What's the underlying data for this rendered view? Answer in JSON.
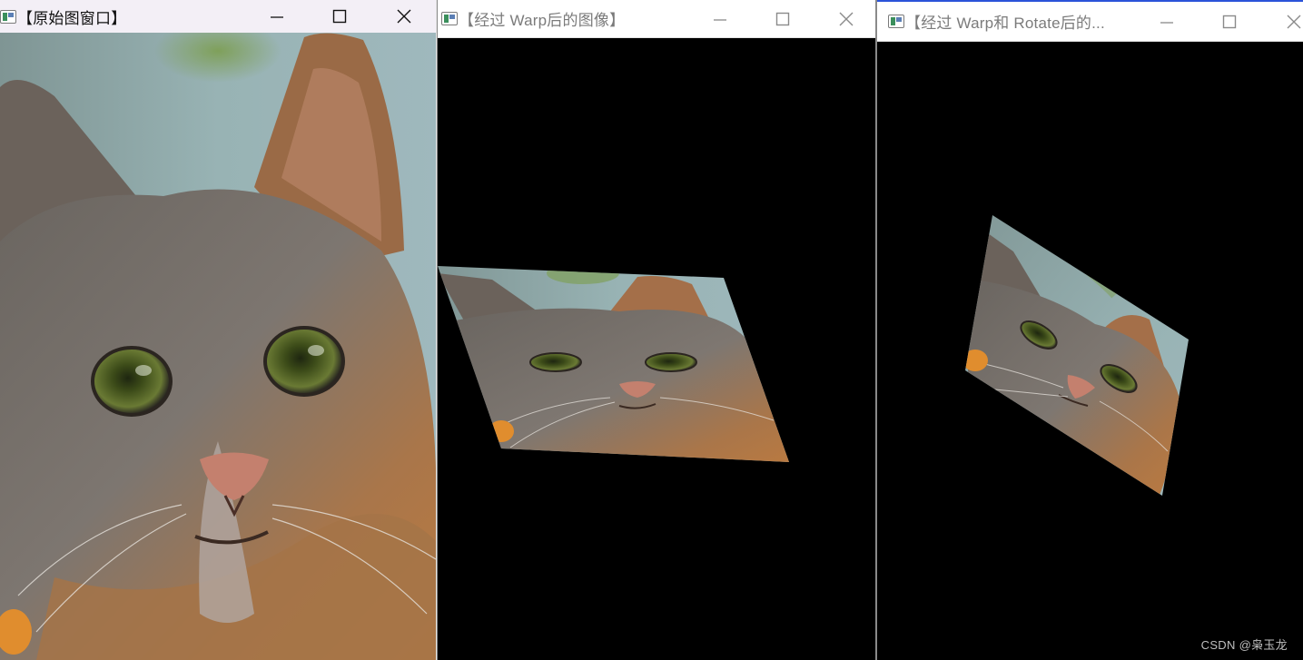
{
  "windows": [
    {
      "title": "【原始图窗口】"
    },
    {
      "title": "【经过 Warp后的图像】"
    },
    {
      "title": "【经过 Warp和 Rotate后的..."
    }
  ],
  "watermark": "CSDN @枭玉龙",
  "colors": {
    "active_titlebar": "#f3eff6",
    "inactive_titlebar": "#ffffff",
    "active_accent": "#2b53d9",
    "canvas": "#000000",
    "fur_dark": "#6f6a66",
    "fur_orange": "#b97a45",
    "background_green_blue": "#8aa7a6",
    "eye_green": "#4c5a22",
    "nose_pink": "#c4806e"
  },
  "icons": [
    "app-window-icon",
    "minimize-icon",
    "maximize-icon",
    "close-icon"
  ]
}
